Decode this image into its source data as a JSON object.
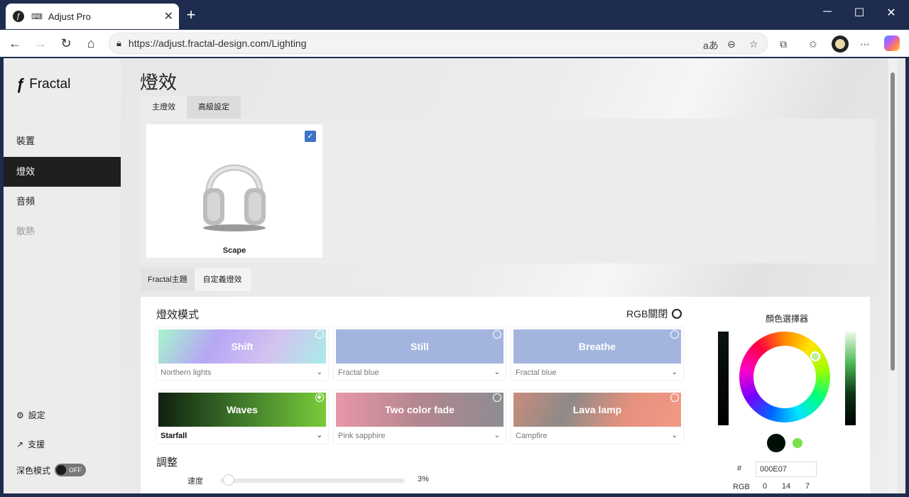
{
  "browser": {
    "tab_title": "Adjust Pro",
    "tab_close": "✕",
    "new_tab": "+",
    "url": "https://adjust.fractal-design.com/Lighting",
    "window_controls": {
      "minimize": "─",
      "maximize": "☐",
      "close": "✕"
    }
  },
  "sidebar": {
    "logo_text": "Fractal",
    "items": [
      {
        "label": "裝置",
        "state": "normal"
      },
      {
        "label": "燈效",
        "state": "active"
      },
      {
        "label": "音頻",
        "state": "normal"
      },
      {
        "label": "散熱",
        "state": "disabled"
      }
    ],
    "settings_label": "設定",
    "support_label": "支援",
    "dark_mode_label": "深色模式",
    "dark_mode_toggle": "OFF"
  },
  "page": {
    "title": "燈效",
    "tabs": [
      "主燈效",
      "高級設定"
    ],
    "device": {
      "name": "Scape",
      "selected": true
    },
    "sub_tabs": [
      "Fractal主題",
      "自定義燈效"
    ]
  },
  "lighting": {
    "mode_title": "燈效模式",
    "rgb_off_label": "RGB關閉",
    "modes": [
      {
        "name": "Shift",
        "preset": "Northern lights",
        "selected": false
      },
      {
        "name": "Still",
        "preset": "Fractal blue",
        "selected": false
      },
      {
        "name": "Breathe",
        "preset": "Fractal blue",
        "selected": false
      },
      {
        "name": "Waves",
        "preset": "Starfall",
        "selected": true
      },
      {
        "name": "Two color fade",
        "preset": "Pink sapphire",
        "selected": false
      },
      {
        "name": "Lava lamp",
        "preset": "Campfire",
        "selected": false
      }
    ],
    "adjust_title": "調整",
    "speed_label": "速度",
    "speed_value": "3%",
    "speed_fraction": 0.03
  },
  "color_picker": {
    "title": "顏色選擇器",
    "hex_label": "#",
    "hex_value": "000E07",
    "rgb_label": "RGB",
    "r": "0",
    "g": "14",
    "b": "7",
    "current_color": "#000E07",
    "accent_color": "#7be04a"
  }
}
